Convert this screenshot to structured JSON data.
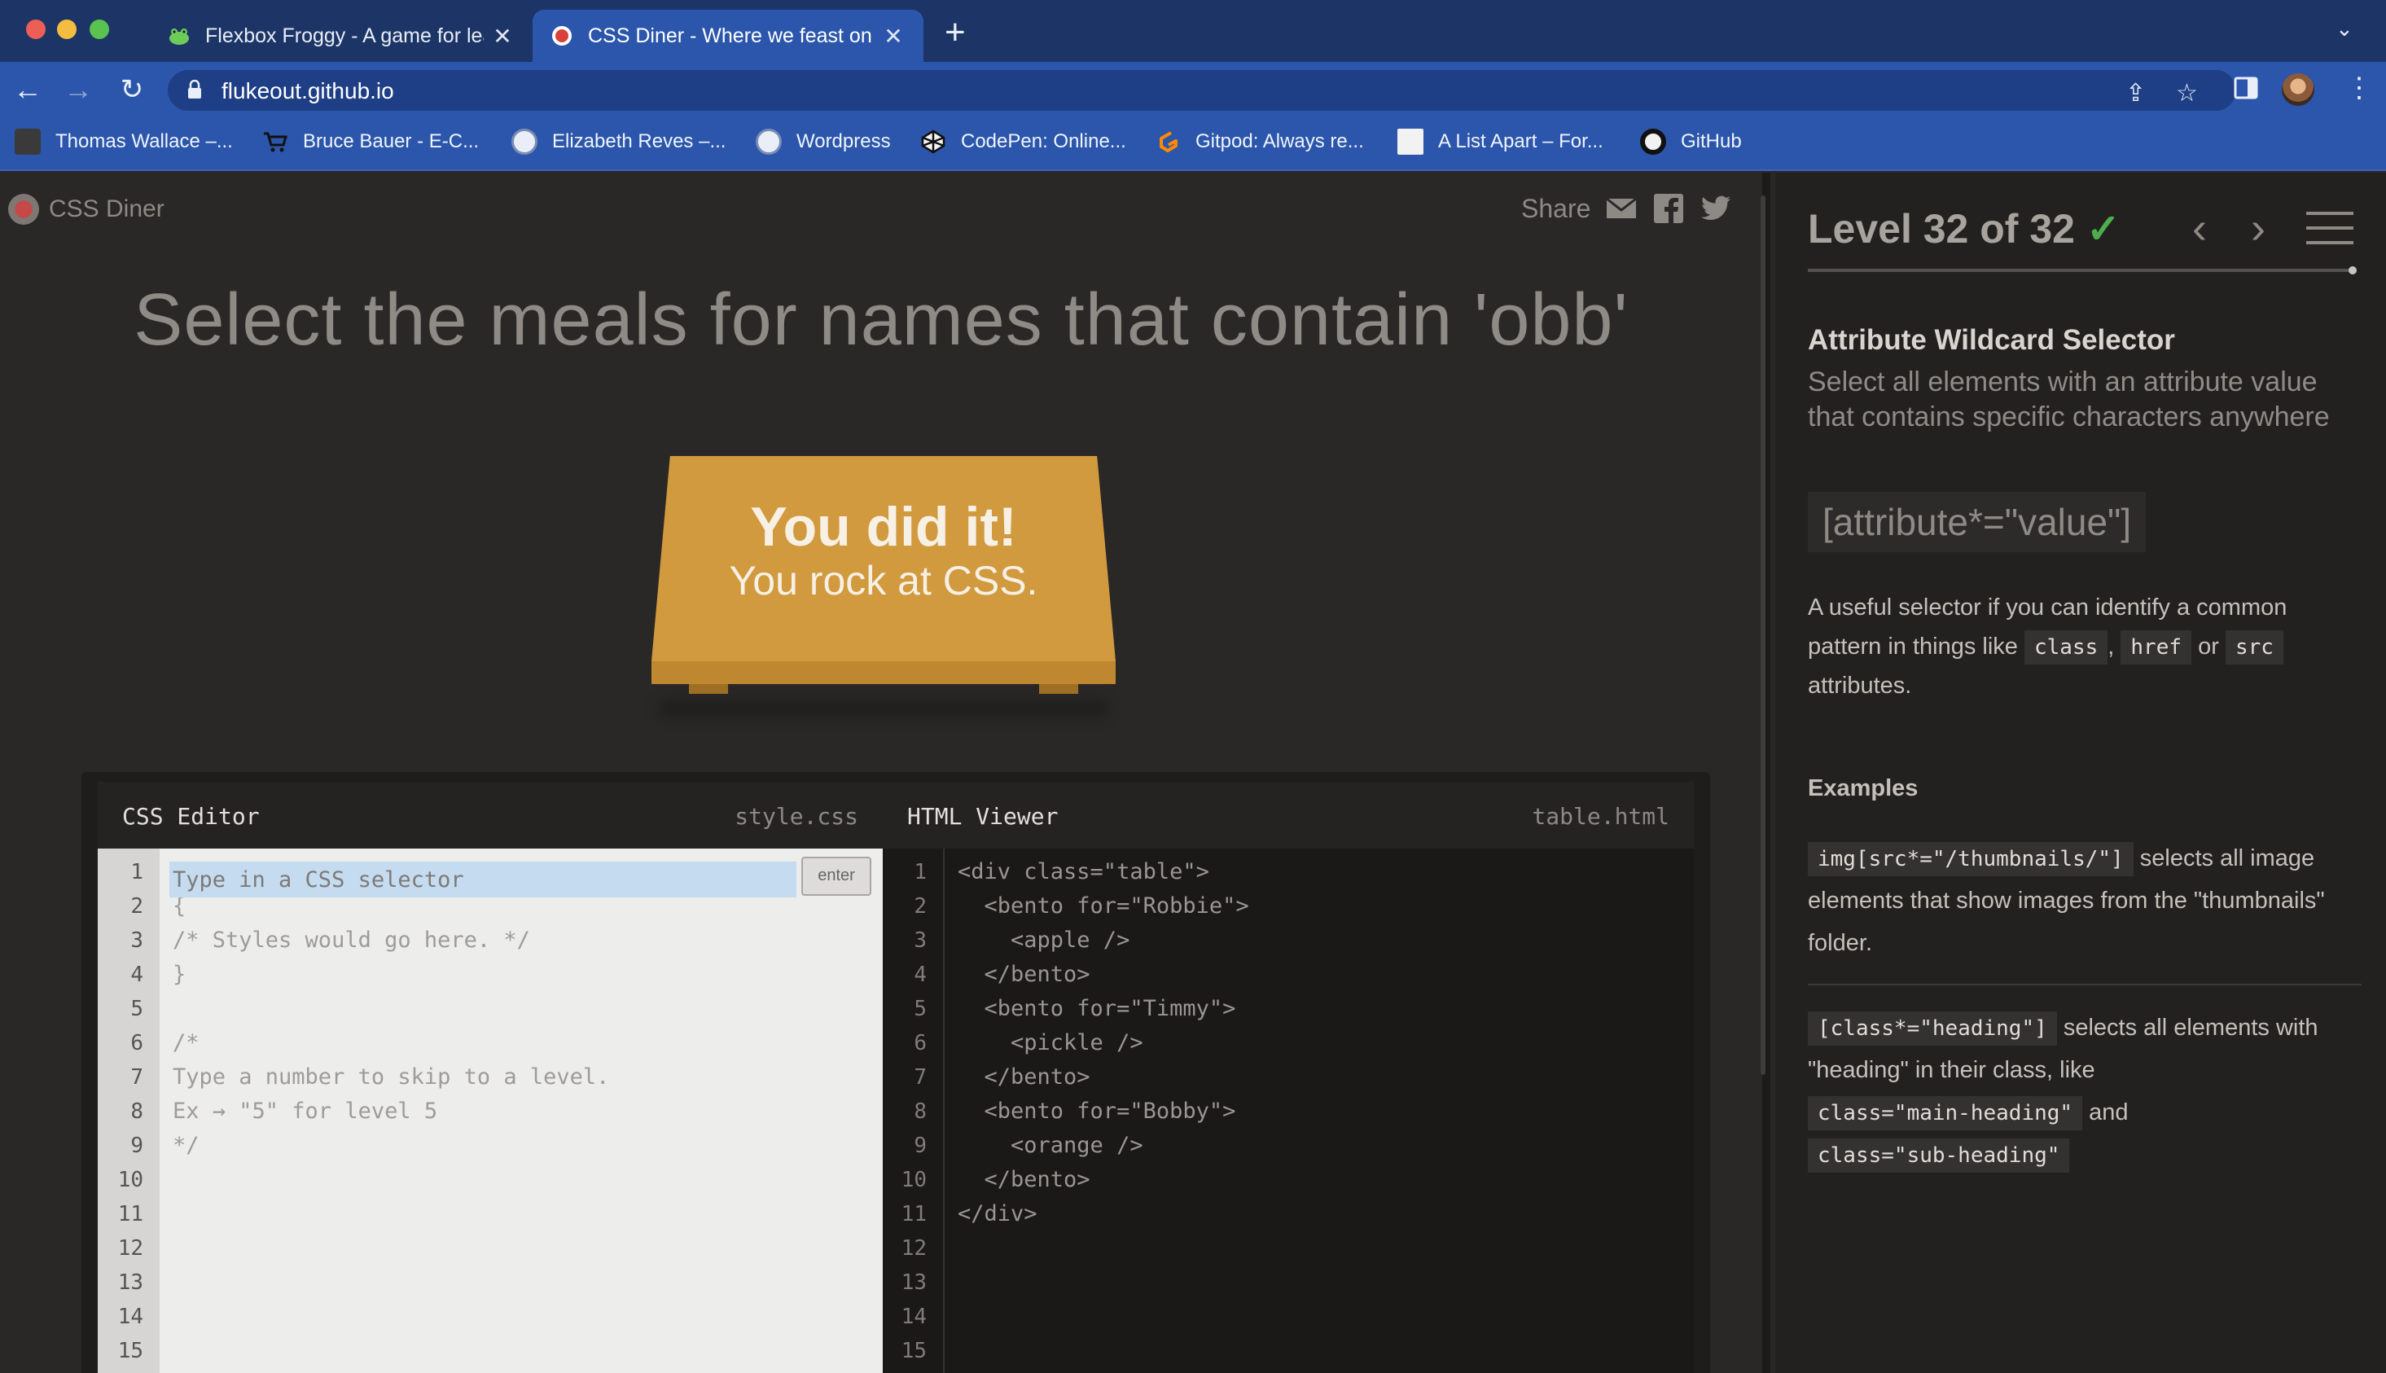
{
  "browser": {
    "tabs": [
      {
        "title": "Flexbox Froggy - A game for learning CSS flexbox",
        "active": false,
        "icon": "frog-icon"
      },
      {
        "title": "CSS Diner - Where we feast on CSS Selectors!",
        "active": true,
        "icon": "css-diner-icon"
      }
    ],
    "new_tab": "+",
    "tab_menu": "⌄",
    "url": "flukeout.github.io",
    "bookmarks": [
      {
        "label": "Thomas Wallace –...",
        "icon": "portrait-icon"
      },
      {
        "label": "Bruce Bauer - E-C...",
        "icon": "cart-icon"
      },
      {
        "label": "Elizabeth Reves –...",
        "icon": "wordpress-icon"
      },
      {
        "label": "Wordpress",
        "icon": "wordpress-icon"
      },
      {
        "label": "CodePen: Online...",
        "icon": "codepen-icon"
      },
      {
        "label": "Gitpod: Always re...",
        "icon": "gitpod-icon"
      },
      {
        "label": "A List Apart – For...",
        "icon": "alistapart-icon"
      },
      {
        "label": "GitHub",
        "icon": "github-icon"
      }
    ]
  },
  "game": {
    "logo": "CSS Diner",
    "share_label": "Share",
    "order": "Select the meals for names that contain 'obb'",
    "win_title": "You did it!",
    "win_sub": "You rock at CSS."
  },
  "editor": {
    "css_title": "CSS Editor",
    "css_file": "style.css",
    "html_title": "HTML Viewer",
    "html_file": "table.html",
    "input_placeholder": "Type in a CSS selector",
    "enter_label": "enter",
    "css_lines": [
      "",
      "{",
      "/* Styles would go here. */",
      "}",
      "",
      "/*",
      "Type a number to skip to a level.",
      "Ex → \"5\" for level 5",
      "*/",
      "",
      "",
      "",
      "",
      "",
      ""
    ],
    "html_lines": [
      "<div class=\"table\">",
      "  <bento for=\"Robbie\">",
      "    <apple />",
      "  </bento>",
      "  <bento for=\"Timmy\">",
      "    <pickle />",
      "  </bento>",
      "  <bento for=\"Bobby\">",
      "    <orange />",
      "  </bento>",
      "</div>",
      "",
      "",
      "",
      ""
    ],
    "line_numbers": [
      "1",
      "2",
      "3",
      "4",
      "5",
      "6",
      "7",
      "8",
      "9",
      "10",
      "11",
      "12",
      "13",
      "14",
      "15"
    ]
  },
  "sidebar": {
    "level": "Level 32 of 32",
    "check": "✓",
    "prev": "‹",
    "next": "›",
    "selector_name": "Attribute Wildcard Selector",
    "selector_desc": "Select all elements with an attribute value that contains specific characters anywhere",
    "syntax": "[attribute*=\"value\"]",
    "hint_pre": "A useful selector if you can identify a common pattern in things like",
    "hint_tag1": "class",
    "hint_sep": ",",
    "hint_tag2": "href",
    "hint_or": "or",
    "hint_tag3": "src",
    "hint_post": "attributes.",
    "examples_title": "Examples",
    "example1_code": "img[src*=\"/thumbnails/\"]",
    "example1_text": "selects all image elements that show images from the \"thumbnails\" folder.",
    "example2_code": "[class*=\"heading\"]",
    "example2_text": "selects all elements with \"heading\" in their class, like",
    "example2_code2": "class=\"main-heading\"",
    "example2_and": "and",
    "example2_code3": "class=\"sub-heading\""
  },
  "colors": {
    "chrome_dark": "#1d3566",
    "chrome": "#2b56ab",
    "page_bg": "#2a2826",
    "table": "#d19a3e",
    "check": "#4cae4c"
  }
}
